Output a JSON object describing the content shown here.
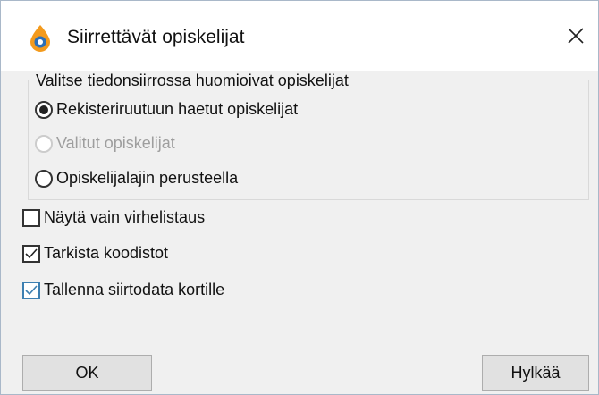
{
  "window": {
    "title": "Siirrettävät opiskelijat",
    "icon": "drop-logo-icon",
    "close_icon": "close-icon"
  },
  "group": {
    "legend": "Valitse tiedonsiirrossa huomioivat opiskelijat",
    "options": [
      {
        "label": "Rekisteriruutuun haetut opiskelijat",
        "selected": true,
        "enabled": true
      },
      {
        "label": "Valitut opiskelijat",
        "selected": false,
        "enabled": false
      },
      {
        "label": "Opiskelijalajin perusteella",
        "selected": false,
        "enabled": true
      }
    ]
  },
  "checkboxes": [
    {
      "label": "Näytä vain virhelistaus",
      "checked": false
    },
    {
      "label": "Tarkista koodistot",
      "checked": true
    },
    {
      "label": "Tallenna siirtodata kortille",
      "checked": true
    }
  ],
  "buttons": {
    "ok": "OK",
    "cancel": "Hylkää"
  },
  "colors": {
    "content_bg": "#f0f0f0",
    "button_bg": "#e1e1e1",
    "focus_blue": "#3c7fb1",
    "icon_orange": "#f39a1d",
    "icon_blue": "#2c6fb7"
  }
}
